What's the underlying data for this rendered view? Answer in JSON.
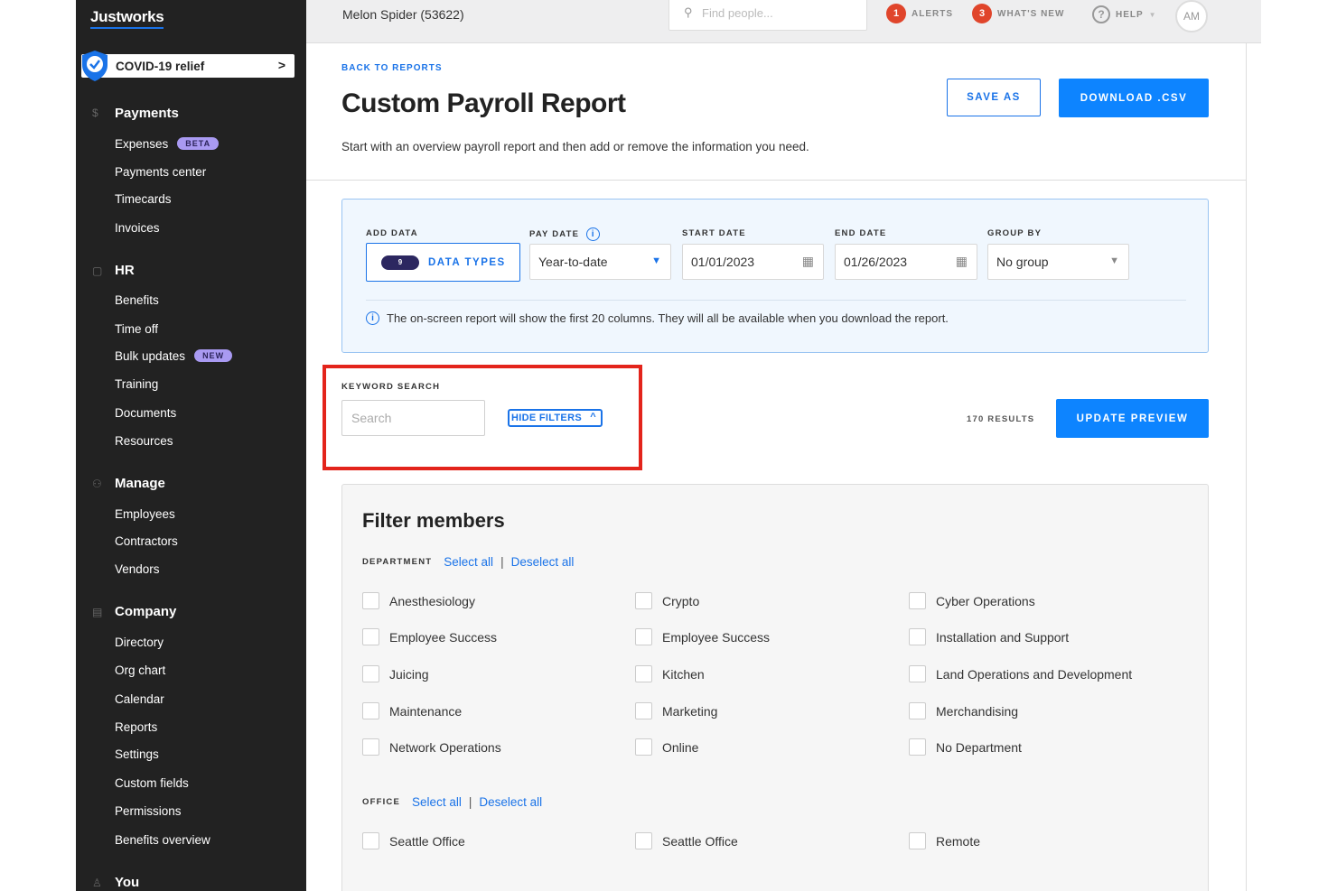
{
  "sidebar": {
    "logo": "Justworks",
    "covid": "COVID-19 relief",
    "payments": {
      "heading": "Payments",
      "expenses": "Expenses",
      "expenses_badge": "BETA",
      "payments_center": "Payments center",
      "timecards": "Timecards",
      "invoices": "Invoices"
    },
    "hr": {
      "heading": "HR",
      "benefits": "Benefits",
      "time_off": "Time off",
      "bulk_updates": "Bulk updates",
      "bulk_badge": "NEW",
      "training": "Training",
      "documents": "Documents",
      "resources": "Resources"
    },
    "manage": {
      "heading": "Manage",
      "employees": "Employees",
      "contractors": "Contractors",
      "vendors": "Vendors"
    },
    "company": {
      "heading": "Company",
      "directory": "Directory",
      "org_chart": "Org chart",
      "calendar": "Calendar",
      "reports": "Reports",
      "settings": "Settings",
      "custom_fields": "Custom fields",
      "permissions": "Permissions",
      "benefits_overview": "Benefits overview"
    },
    "you": {
      "heading": "You"
    }
  },
  "topbar": {
    "company": "Melon Spider (53622)",
    "search_placeholder": "Find people...",
    "alerts_count": "1",
    "alerts": "ALERTS",
    "whats_new_count": "3",
    "whats_new": "WHAT'S NEW",
    "help": "HELP",
    "avatar": "AM"
  },
  "header": {
    "back": "BACK TO REPORTS",
    "title": "Custom Payroll Report",
    "subtitle": "Start with an overview payroll report and then add or remove the information you need.",
    "save_as": "SAVE AS",
    "download": "DOWNLOAD .CSV"
  },
  "controls": {
    "add_data_label": "ADD DATA",
    "data_types_count": "9",
    "data_types": "DATA TYPES",
    "pay_date_label": "PAY DATE",
    "pay_date": "Year-to-date",
    "start_date_label": "START DATE",
    "start_date": "01/01/2023",
    "end_date_label": "END DATE",
    "end_date": "01/26/2023",
    "group_by_label": "GROUP BY",
    "group_by": "No group",
    "notice": "The on-screen report will show the first 20 columns. They will all be available when you download the report."
  },
  "search": {
    "label": "KEYWORD SEARCH",
    "placeholder": "Search",
    "hide_filters": "HIDE FILTERS",
    "results": "170 RESULTS",
    "update_preview": "UPDATE PREVIEW"
  },
  "filters": {
    "title": "Filter members",
    "department_label": "DEPARTMENT",
    "office_label": "OFFICE",
    "select_all": "Select all",
    "deselect_all": "Deselect all",
    "departments": [
      "Anesthesiology",
      "Crypto",
      "Cyber Operations",
      "Employee Success",
      "Employee Success",
      "Installation and Support",
      "Juicing",
      "Kitchen",
      "Land Operations and Development",
      "Maintenance",
      "Marketing",
      "Merchandising",
      "Network Operations",
      "Online",
      "No Department"
    ],
    "offices": [
      "Seattle Office",
      "Seattle Office",
      "Remote"
    ]
  },
  "colors": {
    "accent": "#1a73e8",
    "button": "#0d84ff",
    "sidebar": "#222222",
    "highlight": "#e3241b",
    "alert": "#e0452b"
  }
}
